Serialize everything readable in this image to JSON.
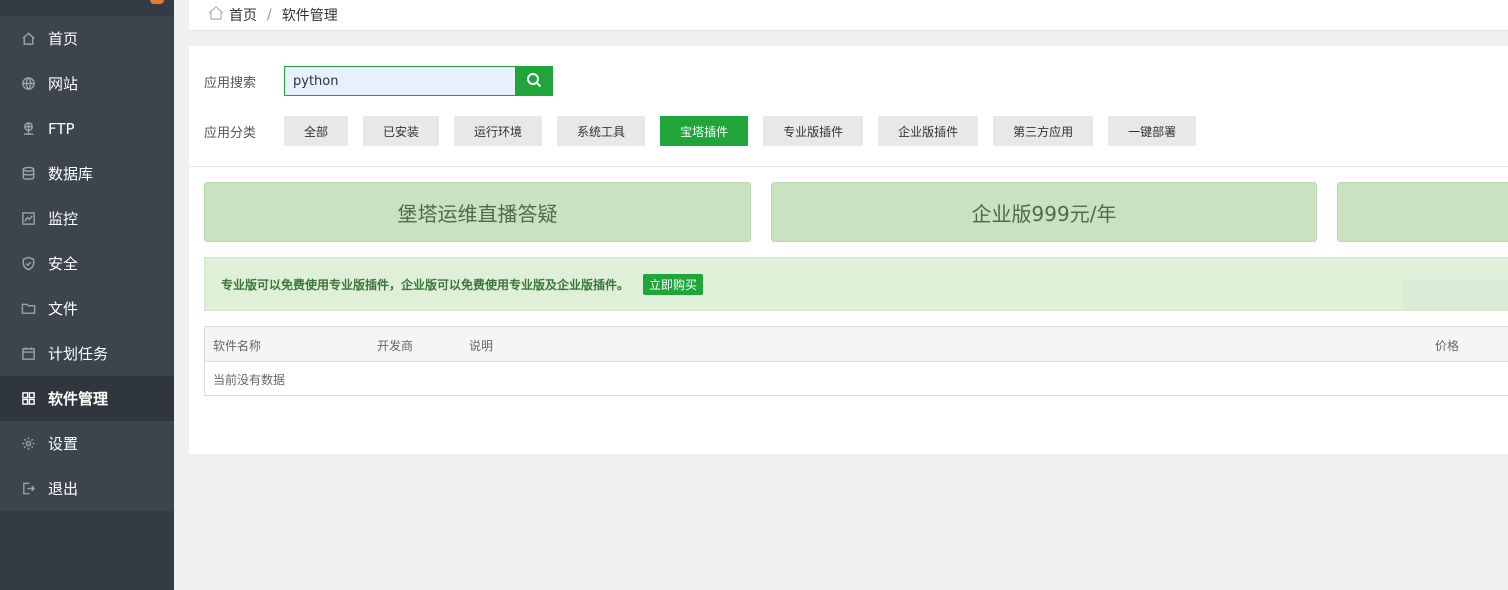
{
  "sidebar": {
    "items": [
      {
        "label": "首页",
        "icon": "home-icon"
      },
      {
        "label": "网站",
        "icon": "globe-icon"
      },
      {
        "label": "FTP",
        "icon": "ftp-icon"
      },
      {
        "label": "数据库",
        "icon": "database-icon"
      },
      {
        "label": "监控",
        "icon": "monitor-icon"
      },
      {
        "label": "安全",
        "icon": "shield-icon"
      },
      {
        "label": "文件",
        "icon": "folder-icon"
      },
      {
        "label": "计划任务",
        "icon": "calendar-icon"
      },
      {
        "label": "软件管理",
        "icon": "grid-icon",
        "active": true
      },
      {
        "label": "设置",
        "icon": "gear-icon"
      },
      {
        "label": "退出",
        "icon": "logout-icon"
      }
    ]
  },
  "breadcrumb": {
    "home": "首页",
    "separator": "/",
    "current": "软件管理"
  },
  "search": {
    "label": "应用搜索",
    "value": "python"
  },
  "categories": {
    "label": "应用分类",
    "items": [
      "全部",
      "已安装",
      "运行环境",
      "系统工具",
      "宝塔插件",
      "专业版插件",
      "企业版插件",
      "第三方应用",
      "一键部署"
    ],
    "active": "宝塔插件"
  },
  "banners": [
    "堡塔运维直播答疑",
    "企业版999元/年"
  ],
  "notice": {
    "text": "专业版可以免费使用专业版插件，企业版可以免费使用专业版及企业版插件。",
    "button": "立即购买"
  },
  "table": {
    "columns": {
      "name": "软件名称",
      "developer": "开发商",
      "description": "说明",
      "price": "价格"
    },
    "empty_text": "当前没有数据"
  },
  "colors": {
    "accent": "#20a53a",
    "sidebar_bg": "#3c444d",
    "banner_bg": "#c9e3c1",
    "notice_bg": "#dff0d8"
  }
}
